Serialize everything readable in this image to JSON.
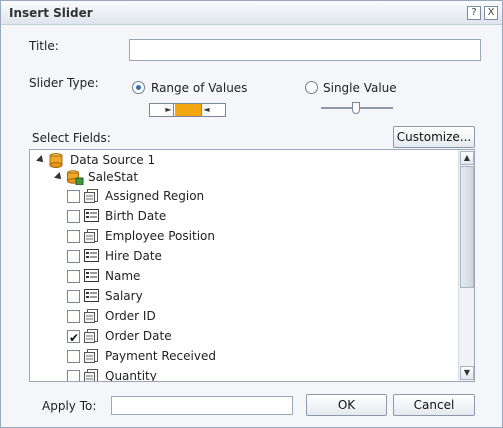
{
  "dialog": {
    "title": "Insert Slider",
    "help_btn": "?",
    "close_btn": "X"
  },
  "form": {
    "title_label": "Title:",
    "title_value": "",
    "slider_type_label": "Slider Type:",
    "range_label": "Range of Values",
    "range_selected": true,
    "single_label": "Single Value",
    "single_selected": false,
    "select_fields_label": "Select Fields:",
    "customize_label": "Customize...",
    "apply_to_label": "Apply To:",
    "apply_to_value": "",
    "ok_label": "OK",
    "cancel_label": "Cancel"
  },
  "tree": {
    "root": "Data Source 1",
    "child": "SaleStat",
    "fields": [
      {
        "label": "Assigned Region",
        "icon": "field-icon",
        "checked": false
      },
      {
        "label": "Birth Date",
        "icon": "date-field-icon",
        "checked": false
      },
      {
        "label": "Employee Position",
        "icon": "field-icon",
        "checked": false
      },
      {
        "label": "Hire Date",
        "icon": "date-field-icon",
        "checked": false
      },
      {
        "label": "Name",
        "icon": "date-field-icon",
        "checked": false
      },
      {
        "label": "Salary",
        "icon": "date-field-icon",
        "checked": false
      },
      {
        "label": "Order ID",
        "icon": "field-icon",
        "checked": false
      },
      {
        "label": "Order Date",
        "icon": "field-icon",
        "checked": true
      },
      {
        "label": "Payment Received",
        "icon": "field-icon",
        "checked": false
      },
      {
        "label": "Quantity",
        "icon": "field-icon",
        "checked": false
      }
    ]
  },
  "colors": {
    "accent": "#f3a60f",
    "border": "#9aa7b8"
  }
}
